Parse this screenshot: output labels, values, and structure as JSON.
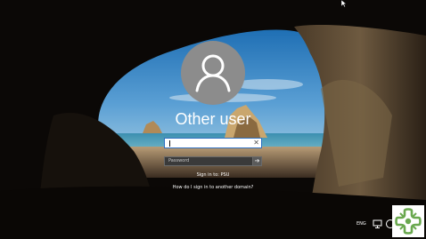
{
  "login": {
    "username_display": "Other user",
    "username_field_value": "",
    "password_placeholder": "Password",
    "sign_in_to": "Sign in to: PSU",
    "domain_help_link": "How do I sign in to another domain?"
  },
  "taskbar": {
    "language": "ENG"
  },
  "icons": {
    "avatar": "user-silhouette-icon",
    "clear": "clear-x-icon",
    "submit": "arrow-right-icon",
    "network": "network-monitor-icon",
    "accessibility": "ease-of-access-icon",
    "logo": "green-cross-logo"
  },
  "colors": {
    "avatar_bg": "#8c8c8c",
    "field_focus_border": "#2d6fc0",
    "logo_green": "#6aa84f"
  }
}
